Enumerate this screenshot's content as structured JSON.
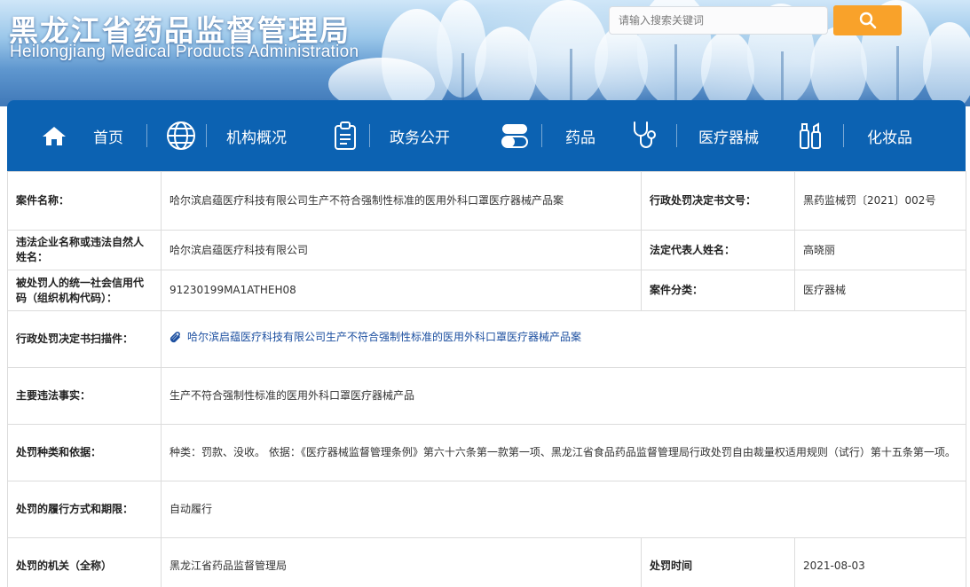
{
  "header": {
    "title_cn": "黑龙江省药品监督管理局",
    "title_en": "Heilongjiang Medical Products Administration",
    "search_placeholder": "请输入搜索关键词"
  },
  "nav": {
    "items": [
      {
        "label": "首页",
        "icon": "home-icon"
      },
      {
        "label": "机构概况",
        "icon": "globe-icon"
      },
      {
        "label": "政务公开",
        "icon": "clipboard-icon"
      },
      {
        "label": "药品",
        "icon": "pill-icon"
      },
      {
        "label": "医疗器械",
        "icon": "stethoscope-icon"
      },
      {
        "label": "化妆品",
        "icon": "cosmetics-icon"
      }
    ]
  },
  "case": {
    "case_name_label": "案件名称：",
    "case_name": "哈尔滨启蕴医疗科技有限公司生产不符合强制性标准的医用外科口罩医疗器械产品案",
    "doc_no_label": "行政处罚决定书文号：",
    "doc_no": "黑药监械罚〔2021〕002号",
    "party_label": "违法企业名称或违法自然人姓名：",
    "party": "哈尔滨启蕴医疗科技有限公司",
    "legal_rep_label": "法定代表人姓名：",
    "legal_rep": "高晓丽",
    "credit_code_label": "被处罚人的统一社会信用代码（组织机构代码）：",
    "credit_code": "91230199MA1ATHEH08",
    "category_label": "案件分类：",
    "category": "医疗器械",
    "scan_label": "行政处罚决定书扫描件：",
    "scan_link": "哈尔滨启蕴医疗科技有限公司生产不符合强制性标准的医用外科口罩医疗器械产品案",
    "facts_label": "主要违法事实：",
    "facts": "生产不符合强制性标准的医用外科口罩医疗器械产品",
    "penalty_label": "处罚种类和依据：",
    "penalty": "种类：罚款、没收。 依据：《医疗器械监督管理条例》第六十六条第一款第一项、黑龙江省食品药品监督管理局行政处罚自由裁量权适用规则（试行）第十五条第一项。",
    "performance_label": "处罚的履行方式和期限：",
    "performance": "自动履行",
    "authority_label": "处罚的机关（全称）",
    "authority": "黑龙江省药品监督管理局",
    "time_label": "处罚时间",
    "time": "2021-08-03"
  },
  "colors": {
    "nav_bg": "#0c62b2",
    "search_button": "#f9a22a",
    "link": "#1c4fa0"
  }
}
